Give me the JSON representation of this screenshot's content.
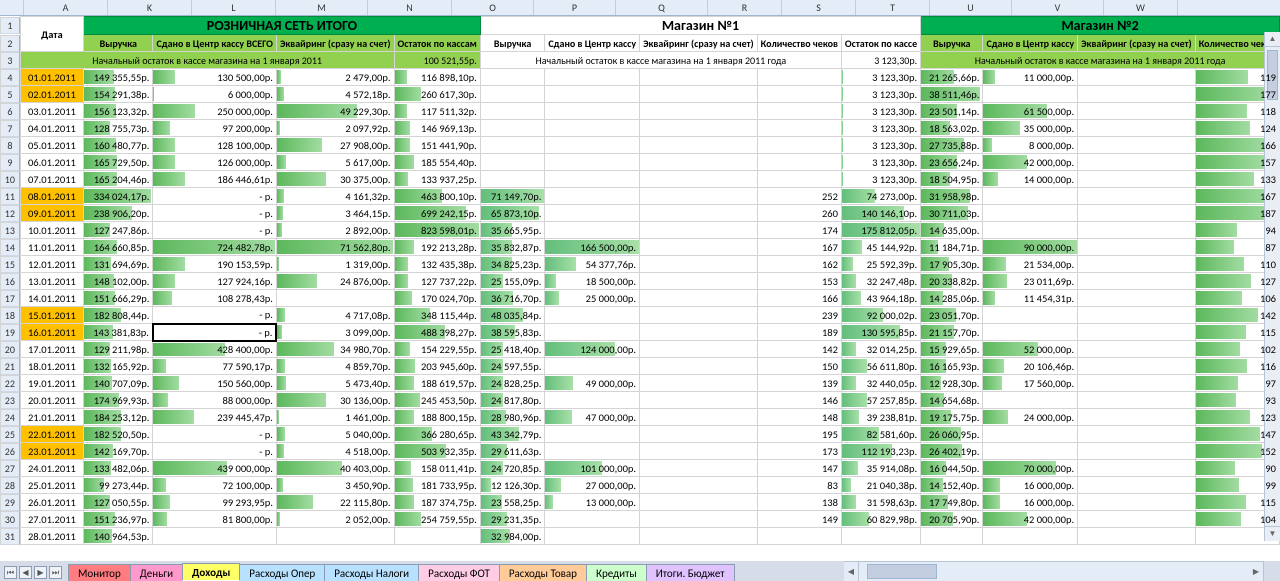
{
  "columns": [
    "A",
    "K",
    "L",
    "M",
    "N",
    "O",
    "P",
    "Q",
    "R",
    "S",
    "T",
    "U",
    "V",
    "W"
  ],
  "group_headers": {
    "A": "Дата",
    "retail": "РОЗНИЧНАЯ СЕТЬ ИТОГО",
    "shop1": "Магазин №1",
    "shop2": "Магазин №2"
  },
  "sub_headers": {
    "K": "Выручка",
    "L": "Сдано в Центр кассу ВСЕГО",
    "M": "Эквайринг (сразу на счет)",
    "N": "Остаток по кассам",
    "O": "Выручка",
    "P": "Сдано в Центр кассу",
    "Q": "Эквайринг (сразу на счет)",
    "R": "Количество чеков",
    "S": "Остаток по кассе",
    "T": "Выручка",
    "U": "Сдано в Центр кассу",
    "V": "Эквайринг (сразу на счет)",
    "W": "Количество чеков"
  },
  "initial_row": {
    "A_N": "Начальный остаток в кассе магазина на 1 января 2011",
    "N_val": "100 521,55р.",
    "O_text": "Начальный остаток в кассе магазина на 1 января 2011 года",
    "S_val": "3 123,30р.",
    "T_text": "Начальный остаток в кассе магазина на 1 января 2011 года"
  },
  "rows": [
    {
      "r": 4,
      "date": "01.01.2011",
      "y": 1,
      "K": "149 355,55р.",
      "L": "130 500,00р.",
      "M": "2 479,00р.",
      "N": "116 898,10р.",
      "O": "",
      "P": "",
      "Q": "",
      "R": "",
      "S": "3 123,30р.",
      "T": "21 265,66р.",
      "U": "11 000,00р.",
      "V": "",
      "W": "119"
    },
    {
      "r": 5,
      "date": "02.01.2011",
      "y": 1,
      "K": "154 291,38р.",
      "L": "6 000,00р.",
      "M": "4 572,18р.",
      "N": "260 617,30р.",
      "O": "",
      "P": "",
      "Q": "",
      "R": "",
      "S": "3 123,30р.",
      "T": "38 511,46р.",
      "U": "",
      "V": "",
      "W": "177"
    },
    {
      "r": 6,
      "date": "03.01.2011",
      "y": 0,
      "K": "156 123,32р.",
      "L": "250 000,00р.",
      "M": "49 229,30р.",
      "N": "117 511,32р.",
      "O": "",
      "P": "",
      "Q": "",
      "R": "",
      "S": "3 123,30р.",
      "T": "23 501,14р.",
      "U": "61 500,00р.",
      "V": "",
      "W": "118"
    },
    {
      "r": 7,
      "date": "04.01.2011",
      "y": 0,
      "K": "128 755,73р.",
      "L": "97 200,00р.",
      "M": "2 097,92р.",
      "N": "146 969,13р.",
      "O": "",
      "P": "",
      "Q": "",
      "R": "",
      "S": "3 123,30р.",
      "T": "18 563,02р.",
      "U": "35 000,00р.",
      "V": "",
      "W": "124"
    },
    {
      "r": 8,
      "date": "05.01.2011",
      "y": 0,
      "K": "160 480,77р.",
      "L": "128 100,00р.",
      "M": "27 908,00р.",
      "N": "151 441,90р.",
      "O": "",
      "P": "",
      "Q": "",
      "R": "",
      "S": "3 123,30р.",
      "T": "27 735,88р.",
      "U": "8 000,00р.",
      "V": "",
      "W": "166"
    },
    {
      "r": 9,
      "date": "06.01.2011",
      "y": 0,
      "K": "165 729,50р.",
      "L": "126 000,00р.",
      "M": "5 617,00р.",
      "N": "185 554,40р.",
      "O": "",
      "P": "",
      "Q": "",
      "R": "",
      "S": "3 123,30р.",
      "T": "23 656,24р.",
      "U": "42 000,00р.",
      "V": "",
      "W": "157"
    },
    {
      "r": 10,
      "date": "07.01.2011",
      "y": 0,
      "K": "165 204,46р.",
      "L": "186 446,61р.",
      "M": "30 375,00р.",
      "N": "133 937,25р.",
      "O": "",
      "P": "",
      "Q": "",
      "R": "",
      "S": "3 123,30р.",
      "T": "18 504,95р.",
      "U": "14 000,00р.",
      "V": "",
      "W": "133"
    },
    {
      "r": 11,
      "date": "08.01.2011",
      "y": 1,
      "K": "334 024,17р.",
      "L": "-   р.",
      "M": "4 161,32р.",
      "N": "463 800,10р.",
      "O": "71 149,70р.",
      "P": "",
      "Q": "",
      "R": "252",
      "S": "74 273,00р.",
      "T": "31 958,98р.",
      "U": "",
      "V": "",
      "W": "167"
    },
    {
      "r": 12,
      "date": "09.01.2011",
      "y": 1,
      "K": "238 906,20р.",
      "L": "-   р.",
      "M": "3 464,15р.",
      "N": "699 242,15р.",
      "O": "65 873,10р.",
      "P": "",
      "Q": "",
      "R": "260",
      "S": "140 146,10р.",
      "T": "30 711,03р.",
      "U": "",
      "V": "",
      "W": "187"
    },
    {
      "r": 13,
      "date": "10.01.2011",
      "y": 0,
      "K": "127 247,86р.",
      "L": "-   р.",
      "M": "2 892,00р.",
      "N": "823 598,01р.",
      "O": "35 665,95р.",
      "P": "",
      "Q": "",
      "R": "174",
      "S": "175 812,05р.",
      "T": "14 635,00р.",
      "U": "",
      "V": "",
      "W": "94"
    },
    {
      "r": 14,
      "date": "11.01.2011",
      "y": 0,
      "K": "164 660,85р.",
      "L": "724 482,78р.",
      "M": "71 562,80р.",
      "N": "192 213,28р.",
      "O": "35 832,87р.",
      "P": "166 500,00р.",
      "Q": "",
      "R": "167",
      "S": "45 144,92р.",
      "T": "11 184,71р.",
      "U": "90 000,00р.",
      "V": "",
      "W": "87"
    },
    {
      "r": 15,
      "date": "12.01.2011",
      "y": 0,
      "K": "131 694,69р.",
      "L": "190 153,59р.",
      "M": "1 319,00р.",
      "N": "132 435,38р.",
      "O": "34 825,23р.",
      "P": "54 377,76р.",
      "Q": "",
      "R": "162",
      "S": "25 592,39р.",
      "T": "17 905,30р.",
      "U": "21 534,00р.",
      "V": "",
      "W": "110"
    },
    {
      "r": 16,
      "date": "13.01.2011",
      "y": 0,
      "K": "148 102,00р.",
      "L": "127 924,16р.",
      "M": "24 876,00р.",
      "N": "127 737,22р.",
      "O": "25 155,09р.",
      "P": "18 500,00р.",
      "Q": "",
      "R": "153",
      "S": "32 247,48р.",
      "T": "20 338,82р.",
      "U": "23 011,69р.",
      "V": "",
      "W": "127"
    },
    {
      "r": 17,
      "date": "14.01.2011",
      "y": 0,
      "K": "151 666,29р.",
      "L": "108 278,43р.",
      "M": "",
      "N": "170 024,70р.",
      "O": "36 716,70р.",
      "P": "25 000,00р.",
      "Q": "",
      "R": "166",
      "S": "43 964,18р.",
      "T": "14 285,06р.",
      "U": "11 454,31р.",
      "V": "",
      "W": "106"
    },
    {
      "r": 18,
      "date": "15.01.2011",
      "y": 1,
      "K": "182 808,44р.",
      "L": "-   р.",
      "M": "4 717,08р.",
      "N": "348 115,44р.",
      "O": "48 035,84р.",
      "P": "",
      "Q": "",
      "R": "239",
      "S": "92 000,02р.",
      "T": "23 051,70р.",
      "U": "",
      "V": "",
      "W": "142"
    },
    {
      "r": 19,
      "date": "16.01.2011",
      "y": 1,
      "K": "143 381,83р.",
      "L": "-   р.",
      "M": "3 099,00р.",
      "N": "488 398,27р.",
      "O": "38 595,83р.",
      "P": "",
      "Q": "",
      "R": "189",
      "S": "130 595,85р.",
      "T": "21 157,70р.",
      "U": "",
      "V": "",
      "W": "115",
      "sel": "L"
    },
    {
      "r": 20,
      "date": "17.01.2011",
      "y": 0,
      "K": "129 211,98р.",
      "L": "428 400,00р.",
      "M": "34 980,70р.",
      "N": "154 229,55р.",
      "O": "25 418,40р.",
      "P": "124 000,00р.",
      "Q": "",
      "R": "142",
      "S": "32 014,25р.",
      "T": "15 929,65р.",
      "U": "52 000,00р.",
      "V": "",
      "W": "102"
    },
    {
      "r": 21,
      "date": "18.01.2011",
      "y": 0,
      "K": "132 165,92р.",
      "L": "77 590,17р.",
      "M": "4 859,70р.",
      "N": "203 945,60р.",
      "O": "24 597,55р.",
      "P": "",
      "Q": "",
      "R": "150",
      "S": "56 611,80р.",
      "T": "16 165,93р.",
      "U": "20 106,46р.",
      "V": "",
      "W": "116"
    },
    {
      "r": 22,
      "date": "19.01.2011",
      "y": 0,
      "K": "140 707,09р.",
      "L": "150 560,00р.",
      "M": "5 473,40р.",
      "N": "188 619,57р.",
      "O": "24 828,25р.",
      "P": "49 000,00р.",
      "Q": "",
      "R": "139",
      "S": "32 440,05р.",
      "T": "12 928,30р.",
      "U": "17 560,00р.",
      "V": "",
      "W": "97"
    },
    {
      "r": 23,
      "date": "20.01.2011",
      "y": 0,
      "K": "174 969,93р.",
      "L": "88 000,00р.",
      "M": "30 136,00р.",
      "N": "245 453,50р.",
      "O": "24 817,80р.",
      "P": "",
      "Q": "",
      "R": "146",
      "S": "57 257,85р.",
      "T": "14 654,68р.",
      "U": "",
      "V": "",
      "W": "93"
    },
    {
      "r": 24,
      "date": "21.01.2011",
      "y": 0,
      "K": "184 253,12р.",
      "L": "239 445,47р.",
      "M": "1 461,00р.",
      "N": "188 800,15р.",
      "O": "28 980,96р.",
      "P": "47 000,00р.",
      "Q": "",
      "R": "148",
      "S": "39 238,81р.",
      "T": "19 175,75р.",
      "U": "24 000,00р.",
      "V": "",
      "W": "123"
    },
    {
      "r": 25,
      "date": "22.01.2011",
      "y": 1,
      "K": "182 520,50р.",
      "L": "-   р.",
      "M": "5 040,00р.",
      "N": "366 280,65р.",
      "O": "43 342,79р.",
      "P": "",
      "Q": "",
      "R": "195",
      "S": "82 581,60р.",
      "T": "26 060,95р.",
      "U": "",
      "V": "",
      "W": "147"
    },
    {
      "r": 26,
      "date": "23.01.2011",
      "y": 1,
      "K": "142 169,70р.",
      "L": "-   р.",
      "M": "4 518,00р.",
      "N": "503 932,35р.",
      "O": "29 611,63р.",
      "P": "",
      "Q": "",
      "R": "173",
      "S": "112 193,23р.",
      "T": "26 402,19р.",
      "U": "",
      "V": "",
      "W": "152"
    },
    {
      "r": 27,
      "date": "24.01.2011",
      "y": 0,
      "K": "133 482,06р.",
      "L": "439 000,00р.",
      "M": "40 403,00р.",
      "N": "158 011,41р.",
      "O": "24 720,85р.",
      "P": "101 000,00р.",
      "Q": "",
      "R": "147",
      "S": "35 914,08р.",
      "T": "16 044,50р.",
      "U": "70 000,00р.",
      "V": "",
      "W": "90"
    },
    {
      "r": 28,
      "date": "25.01.2011",
      "y": 0,
      "K": "99 273,44р.",
      "L": "72 100,00р.",
      "M": "3 450,90р.",
      "N": "181 733,95р.",
      "O": "12 126,30р.",
      "P": "27 000,00р.",
      "Q": "",
      "R": "83",
      "S": "21 040,38р.",
      "T": "14 152,40р.",
      "U": "16 000,00р.",
      "V": "",
      "W": "99"
    },
    {
      "r": 29,
      "date": "26.01.2011",
      "y": 0,
      "K": "127 050,55р.",
      "L": "99 293,95р.",
      "M": "22 115,80р.",
      "N": "187 374,75р.",
      "O": "23 558,25р.",
      "P": "13 000,00р.",
      "Q": "",
      "R": "138",
      "S": "31 598,63р.",
      "T": "17 749,80р.",
      "U": "16 000,00р.",
      "V": "",
      "W": "115"
    },
    {
      "r": 30,
      "date": "27.01.2011",
      "y": 0,
      "K": "151 236,97р.",
      "L": "81 800,00р.",
      "M": "2 052,00р.",
      "N": "254 759,55р.",
      "O": "29 231,35р.",
      "P": "",
      "Q": "",
      "R": "149",
      "S": "60 829,98р.",
      "T": "20 705,90р.",
      "U": "42 000,00р.",
      "V": "",
      "W": "104"
    },
    {
      "r": 31,
      "date": "28.01.2011",
      "y": 0,
      "K": "140 964,53р.",
      "L": "",
      "M": "",
      "N": "",
      "O": "32 984,00р.",
      "P": "",
      "Q": "",
      "R": "",
      "S": "",
      "T": "",
      "U": "",
      "V": "",
      "W": ""
    }
  ],
  "bar_max": {
    "K": 340000,
    "L": 730000,
    "M": 72000,
    "N": 830000,
    "O": 72000,
    "P": 167000,
    "S": 176000,
    "T": 40000,
    "U": 90000,
    "W": 190
  },
  "tabs": [
    {
      "label": "Монитор",
      "cls": "red"
    },
    {
      "label": "Деньги",
      "cls": "pink"
    },
    {
      "label": "Доходы",
      "cls": "yellow",
      "active": true
    },
    {
      "label": "Расходы Опер",
      "cls": "sky"
    },
    {
      "label": "Расходы Налоги",
      "cls": "sky"
    },
    {
      "label": "Расходы ФОТ",
      "cls": "ltpink"
    },
    {
      "label": "Расходы Товар",
      "cls": "orange"
    },
    {
      "label": "Кредиты",
      "cls": "ltgrn"
    },
    {
      "label": "Итоги. Бюджет",
      "cls": "purple"
    }
  ]
}
